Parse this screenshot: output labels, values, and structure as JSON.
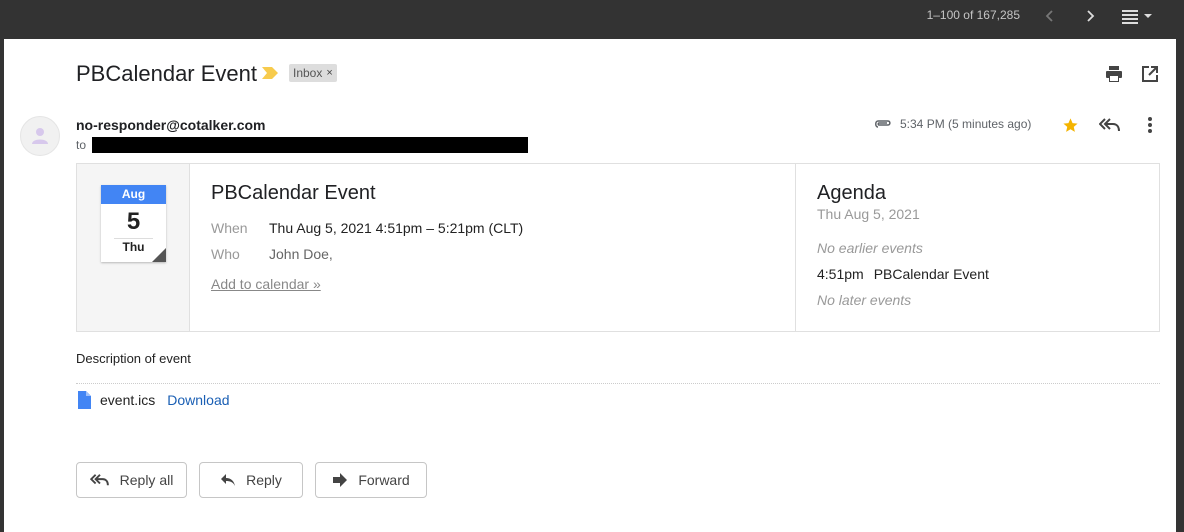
{
  "topbar": {
    "pager": "1–100 of 167,285"
  },
  "email": {
    "subject": "PBCalendar Event",
    "label": "Inbox",
    "label_remove": "×",
    "sender": "no-responder@cotalker.com",
    "to_prefix": "to",
    "time": "5:34 PM (5 minutes ago)"
  },
  "invite": {
    "cal_month": "Aug",
    "cal_day": "5",
    "cal_dow": "Thu",
    "title": "PBCalendar Event",
    "when_label": "When",
    "when_value": "Thu Aug 5, 2021 4:51pm – 5:21pm (CLT)",
    "who_label": "Who",
    "who_value": "John Doe,",
    "add_to_calendar": "Add to calendar »"
  },
  "agenda": {
    "title": "Agenda",
    "date": "Thu Aug 5, 2021",
    "no_earlier": "No earlier events",
    "event_time": "4:51pm",
    "event_name": "PBCalendar Event",
    "no_later": "No later events"
  },
  "body": {
    "description": "Description of event"
  },
  "attachment": {
    "name": "event.ics",
    "download": "Download"
  },
  "actions": {
    "reply_all": "Reply all",
    "reply": "Reply",
    "forward": "Forward"
  },
  "colors": {
    "accent_blue": "#4285f4",
    "link_blue": "#1a5fb4",
    "star": "#f4b400",
    "importance": "#f7cb4d"
  },
  "icons": [
    "chevron-left-icon",
    "chevron-right-icon",
    "density-menu-icon",
    "importance-marker-icon",
    "print-icon",
    "open-new-window-icon",
    "avatar-icon",
    "attachment-clip-icon",
    "star-icon",
    "reply-all-icon",
    "more-vert-icon",
    "file-icon",
    "reply-icon",
    "forward-icon"
  ]
}
